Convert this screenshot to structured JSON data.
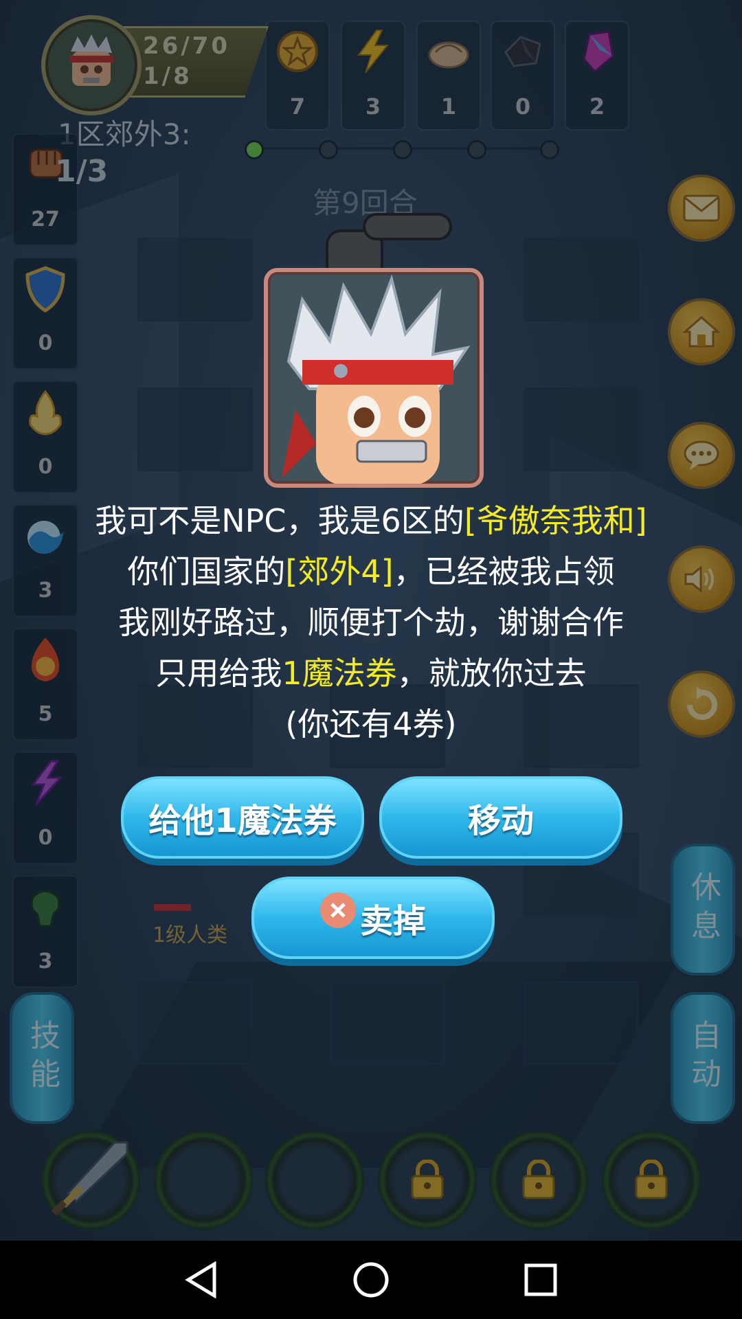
{
  "hud": {
    "hp": "26/70",
    "level_progress": "1/8",
    "resources": [
      {
        "icon": "gold-coin-icon",
        "count": "7"
      },
      {
        "icon": "lightning-icon",
        "count": "3"
      },
      {
        "icon": "dumpling-icon",
        "count": "1"
      },
      {
        "icon": "ore-icon",
        "count": "0"
      },
      {
        "icon": "crystal-icon",
        "count": "2"
      }
    ],
    "zone": "1区郊外3:",
    "wave": "1/3",
    "round": "第9回合",
    "progress_dots": 5,
    "progress_active": 1
  },
  "stats": [
    {
      "icon": "fist-icon",
      "value": "27"
    },
    {
      "icon": "shield-icon",
      "value": "0"
    },
    {
      "icon": "holy-flame-icon",
      "value": "0"
    },
    {
      "icon": "water-wave-icon",
      "value": "3"
    },
    {
      "icon": "fire-icon",
      "value": "5"
    },
    {
      "icon": "lightning-crystal-icon",
      "value": "0"
    },
    {
      "icon": "poison-icon",
      "value": "3"
    }
  ],
  "right_buttons": [
    "mail-icon",
    "home-icon",
    "chat-icon",
    "sound-icon",
    "back-arrow-icon"
  ],
  "side_pills": {
    "rest": "休息",
    "auto": "自动",
    "skill": "技能"
  },
  "dialog": {
    "line1_prefix": "我可不是NPC，我是6区的",
    "line1_highlight": "[爷傲奈我和]",
    "line2_prefix": "你们国家的",
    "line2_highlight": "[郊外4]",
    "line2_suffix": "，已经被我占领",
    "line3": "我刚好路过，顺便打个劫，谢谢合作",
    "line4_prefix": "只用给我",
    "line4_highlight": "1魔法券",
    "line4_suffix": "，就放你过去",
    "line5": "(你还有4券)",
    "btn_pay": "给他1魔法券",
    "btn_move": "移动",
    "btn_sell": "卖掉"
  },
  "unit_label": "1级人类",
  "skill_slots": [
    "sword-icon",
    "empty",
    "empty",
    "lock-icon",
    "lock-icon",
    "lock-icon"
  ],
  "colors": {
    "highlight": "#f7ec1e",
    "button": "#2fb7ea",
    "gold": "#e8a92a"
  }
}
